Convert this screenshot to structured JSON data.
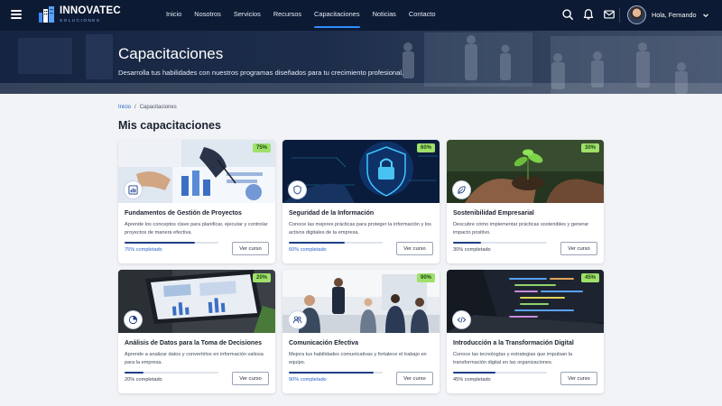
{
  "brand": {
    "name": "INNOVATEC",
    "tagline": "SOLUCIONES"
  },
  "nav": {
    "links": [
      {
        "label": "Inicio"
      },
      {
        "label": "Nosotros"
      },
      {
        "label": "Servicios"
      },
      {
        "label": "Recursos"
      },
      {
        "label": "Capacitaciones"
      },
      {
        "label": "Noticias"
      },
      {
        "label": "Contacto"
      }
    ],
    "active": "Capacitaciones",
    "icons": [
      "search-icon",
      "bell-icon",
      "mail-icon"
    ],
    "user_greeting": "Hola, Fernando"
  },
  "hero": {
    "title": "Capacitaciones",
    "subtitle": "Desarrolla tus habilidades con nuestros programas diseñados para tu crecimiento profesional."
  },
  "breadcrumb": {
    "home": "Inicio",
    "separator": "/",
    "current": "Capacitaciones"
  },
  "section_title": "Mis capacitaciones",
  "courses": [
    {
      "title": "Fundamentos de Gestión de Proyectos",
      "description": "Aprende los conceptos clave para planificar, ejecutar y controlar proyectos de manera efectiva.",
      "badge": "75%",
      "progress": 0.75,
      "progress_label": "75% completado",
      "button": "Ver curso",
      "icon": "chart-icon"
    },
    {
      "title": "Seguridad de la Información",
      "description": "Conoce las mejores prácticas para proteger la información y los activos digitales de la empresa.",
      "badge": "60%",
      "progress": 0.6,
      "progress_label": "60% completado",
      "button": "Ver curso",
      "icon": "shield-icon"
    },
    {
      "title": "Sostenibilidad Empresarial",
      "description": "Descubre cómo implementar prácticas sostenibles y generar impacto positivo.",
      "badge": "30%",
      "progress": 0.3,
      "progress_label": "30% completado",
      "button": "Ver curso",
      "icon": "leaf-icon"
    },
    {
      "title": "Análisis de Datos para la Toma de Decisiones",
      "description": "Aprende a analizar datos y convertirlos en información valiosa para la empresa.",
      "badge": "20%",
      "progress": 0.2,
      "progress_label": "20% completado",
      "button": "Ver curso",
      "icon": "pie-chart-icon"
    },
    {
      "title": "Comunicación Efectiva",
      "description": "Mejora tus habilidades comunicativas y fortalece el trabajo en equipo.",
      "badge": "90%",
      "progress": 0.9,
      "progress_label": "90% completado",
      "button": "Ver curso",
      "icon": "users-icon"
    },
    {
      "title": "Introducción a la Transformación Digital",
      "description": "Conoce las tecnologías y estrategias que impulsan la transformación digital en las organizaciones.",
      "badge": "45%",
      "progress": 0.45,
      "progress_label": "45% completado",
      "button": "Ver curso",
      "icon": "code-icon"
    }
  ],
  "colors": {
    "navbar": "#0c1a33",
    "accent": "#2f8cff",
    "badge": "#9fe06a",
    "progress": "#1d3f86",
    "link": "#2a62c9"
  }
}
